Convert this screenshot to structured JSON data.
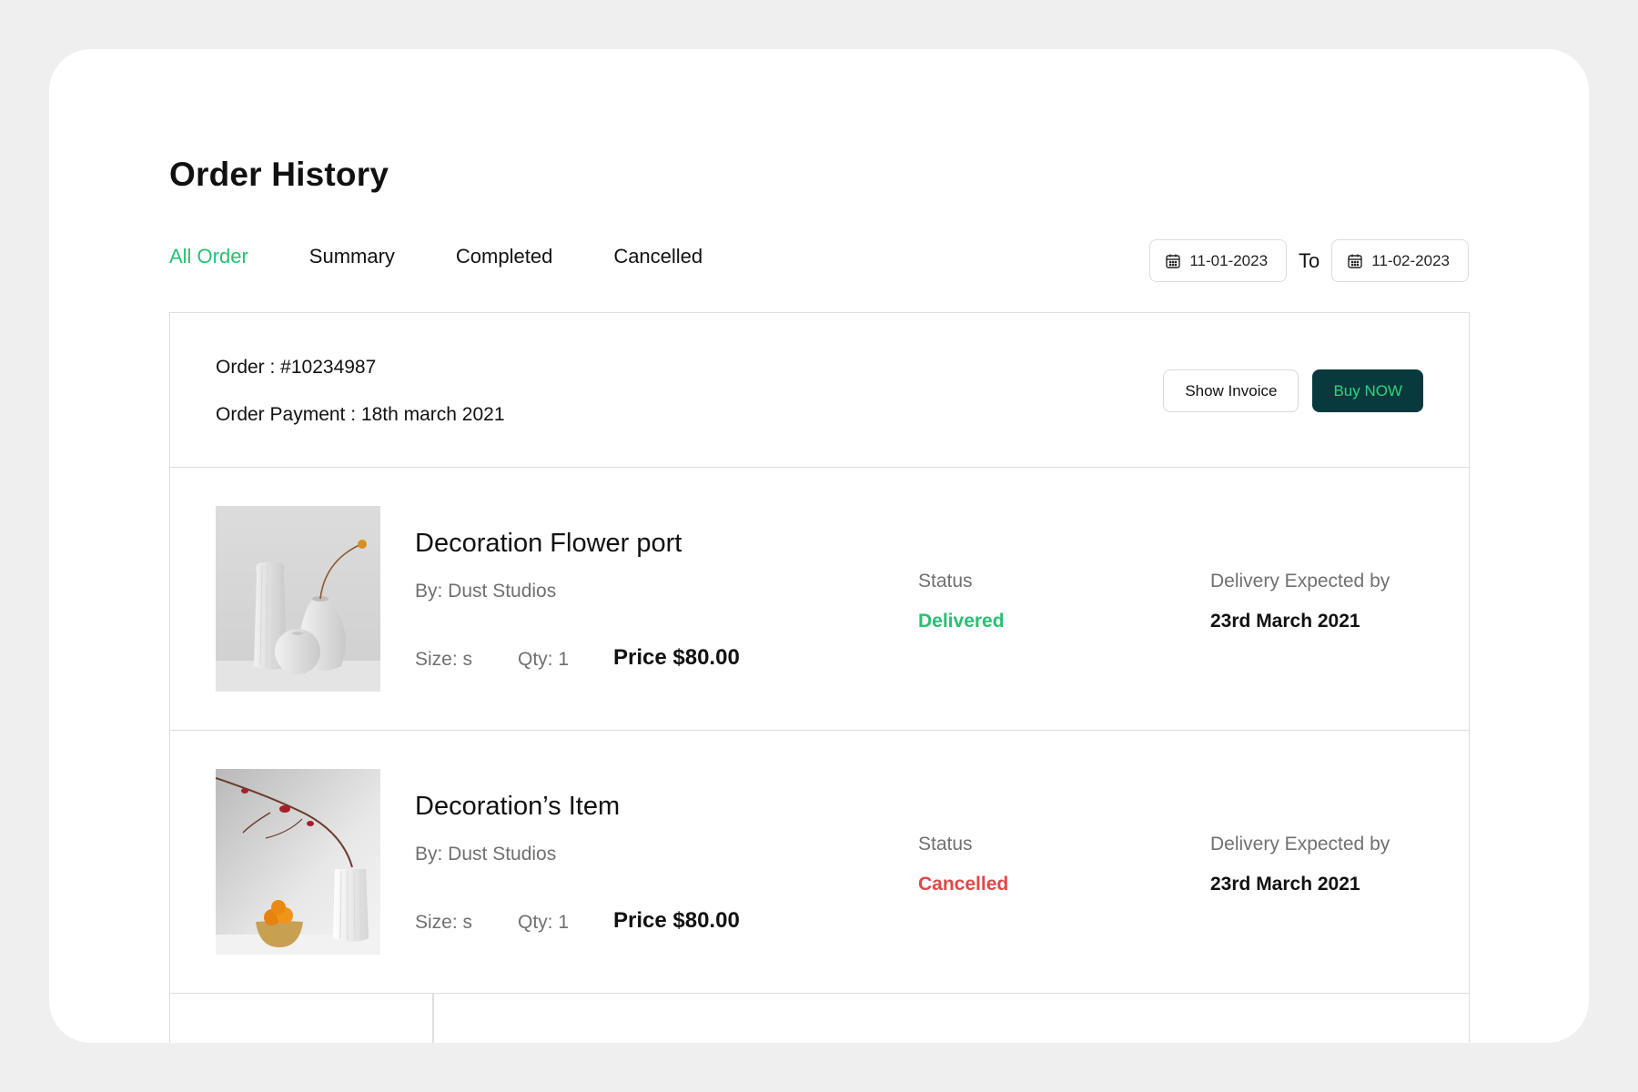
{
  "header": {
    "title": "Order History"
  },
  "tabs": [
    {
      "label": "All Order",
      "active": true
    },
    {
      "label": "Summary",
      "active": false
    },
    {
      "label": "Completed",
      "active": false
    },
    {
      "label": "Cancelled",
      "active": false
    }
  ],
  "date_range": {
    "from": "11-01-2023",
    "to_label": "To",
    "to": "11-02-2023",
    "icon": "calendar-icon"
  },
  "order": {
    "id_text": "Order : #10234987",
    "payment_text": "Order Payment : 18th march 2021",
    "show_invoice_label": "Show Invoice",
    "buy_now_label": "Buy NOW"
  },
  "items": [
    {
      "name": "Decoration Flower port",
      "by": "By: Dust Studios",
      "size": "Size: s",
      "qty": "Qty: 1",
      "price": "Price $80.00",
      "status_label": "Status",
      "status": "Delivered",
      "delivery_label": "Delivery Expected by",
      "delivery_date": "23rd March 2021"
    },
    {
      "name": "Decoration’s Item",
      "by": "By: Dust Studios",
      "size": "Size: s",
      "qty": "Qty: 1",
      "price": "Price $80.00",
      "status_label": "Status",
      "status": "Cancelled",
      "delivery_label": "Delivery Expected by",
      "delivery_date": "23rd March 2021"
    }
  ],
  "colors": {
    "accent_green": "#27c173",
    "dark_button": "#07393d",
    "cancelled_red": "#e04848",
    "muted_text": "#707070"
  }
}
